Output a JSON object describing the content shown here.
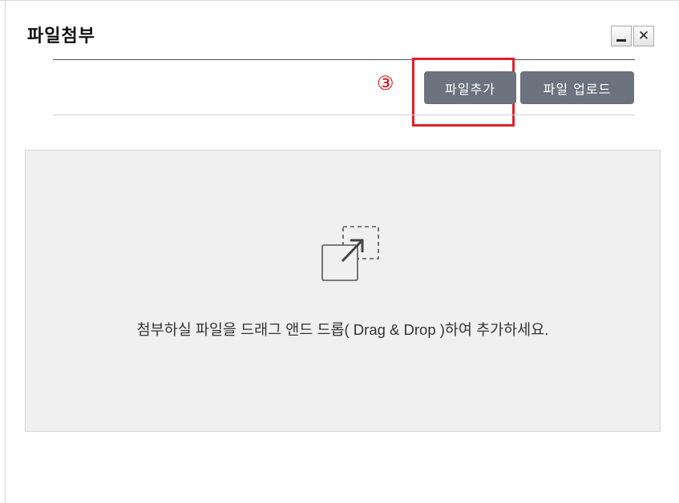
{
  "dialog": {
    "title": "파일첨부",
    "minimize_glyph": "minimize-icon",
    "close_glyph": "✕"
  },
  "toolbar": {
    "step_marker": "③",
    "add_file_label": "파일추가",
    "upload_label": "파일 업로드"
  },
  "drop_zone": {
    "icon": "drag-drop-icon",
    "message": "첨부하실 파일을  드래그 앤드 드롭( Drag & Drop )하여 추가하세요."
  },
  "colors": {
    "button_bg": "#6c737e",
    "highlight": "#e0202a",
    "step_marker": "#e00000",
    "drop_zone_bg": "#f0f0f0"
  }
}
